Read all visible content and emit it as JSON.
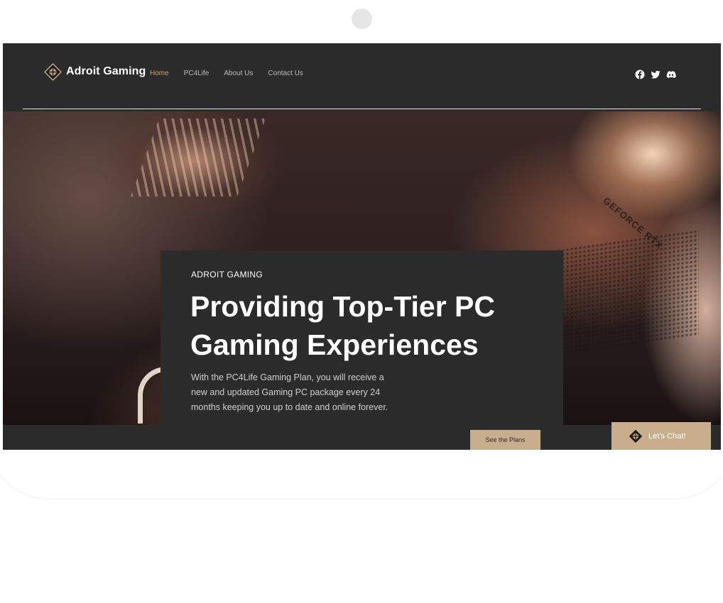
{
  "header": {
    "brand": "Adroit Gaming",
    "nav": [
      {
        "label": "Home",
        "active": true
      },
      {
        "label": "PC4Life",
        "active": false
      },
      {
        "label": "About Us",
        "active": false
      },
      {
        "label": "Contact Us",
        "active": false
      }
    ],
    "social_icons": [
      "facebook-icon",
      "twitter-icon",
      "discord-icon"
    ]
  },
  "hero": {
    "eyebrow": "ADROIT GAMING",
    "headline": "Providing Top-Tier PC Gaming Experiences",
    "body": "With the PC4Life Gaming Plan, you will receive a new and updated Gaming PC package every 24 months keeping you up to date and online forever.",
    "cta_label": "See the Plans",
    "image_text": "GEFORCE RTX"
  },
  "chat": {
    "label": "Let’s Chat!"
  },
  "colors": {
    "accent": "#c8ae8c",
    "nav_active": "#c8a27a",
    "panel": "#2b2b2b",
    "text_primary": "#ffffff",
    "text_muted": "#cfcfcf"
  }
}
